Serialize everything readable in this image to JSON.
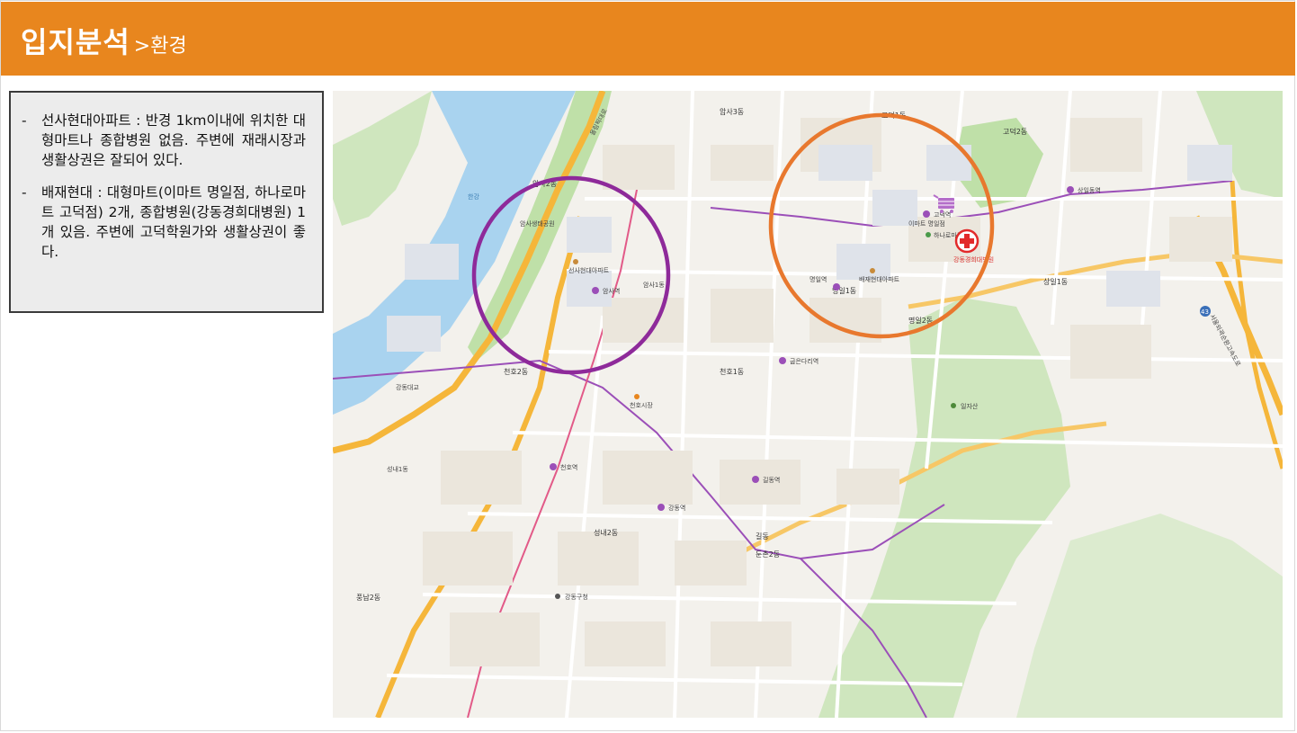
{
  "header": {
    "title": "입지분석",
    "separator": ">",
    "subtitle": "환경"
  },
  "info": {
    "items": [
      {
        "dash": "-",
        "text": "선사현대아파트 : 반경 1km이내에 위치한 대형마트나 종합병원 없음. 주변에 재래시장과 생활상권은 잘되어 있다."
      },
      {
        "dash": "-",
        "text": "배재현대 : 대형마트(이마트 명일점, 하나로마트 고덕점) 2개, 종합병원(강동경희대병원) 1개 있음. 주변에 고덕학원가와 생활상권이 좋다."
      }
    ]
  },
  "map": {
    "labels": {
      "amsa3": "암사3동",
      "amsa2": "암사2동",
      "amsa1": "암사1동",
      "myeongil1": "명일1동",
      "myeongil2": "명일2동",
      "godeok1": "고덕1동",
      "godeok2": "고덕2동",
      "sangil1": "상일1동",
      "cheonho2": "천호2동",
      "cheonho1": "천호1동",
      "seongnae1": "성내1동",
      "seongnae2": "성내2동",
      "gildong": "길동",
      "dunchon2": "둔촌2동",
      "pungnap2": "풍납2동",
      "amsa_st": "암사역",
      "cheonho_st": "천호역",
      "gangdong_st": "강동역",
      "gildong_st": "길동역",
      "gubeundari_st": "굽은다리역",
      "godeok_st": "고덕역",
      "myeongil_st": "명일역",
      "sangil_st": "상일동역",
      "gangdong_gu_office": "강동구청",
      "kyunghee_hospital": "강동경희대병원",
      "emart": "이마트 명일점",
      "hanaro": "하나로마트",
      "seonsa_apt": "선사현대아파트",
      "baejae_apt": "배재현대아파트",
      "cheonho_market": "천호시장",
      "amsa_park": "암사생태공원",
      "ilja_mountain": "일자산",
      "gangdong_bridge": "강동대교",
      "olympic_road": "올림픽대로",
      "seoul_ring": "서울외곽순환고속도로",
      "route43": "43",
      "han_river": "한강"
    },
    "colors": {
      "purple_circle": "#8e2a9a",
      "orange_circle": "#e8782e",
      "river": "#a9d3ef",
      "highway": "#f5b63a",
      "greens": "#bfe0a8",
      "road": "#ffffff"
    },
    "icons": {
      "mart": "shopping-cart-icon",
      "hospital": "red-cross-icon"
    }
  }
}
